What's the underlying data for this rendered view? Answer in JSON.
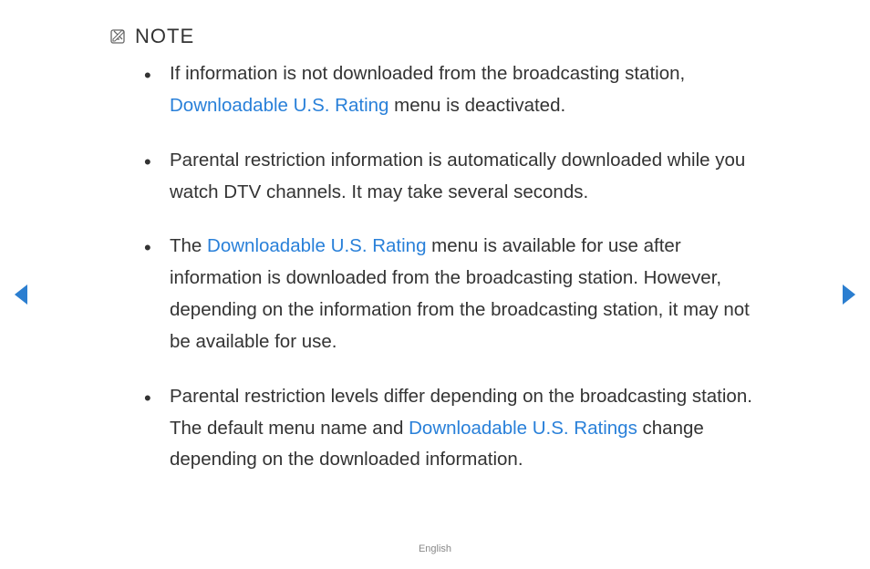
{
  "header": {
    "label": "NOTE"
  },
  "bullets": [
    {
      "pre": "If information is not downloaded from the broadcasting station, ",
      "link": "Downloadable U.S. Rating",
      "post": " menu is deactivated."
    },
    {
      "pre": "Parental restriction information is automatically downloaded while you watch DTV channels. It may take several seconds.",
      "link": "",
      "post": ""
    },
    {
      "pre": "The ",
      "link": "Downloadable U.S. Rating",
      "post": " menu is available for use after information is downloaded from the broadcasting station. However, depending on the information from the broadcasting station, it may not be available for use."
    },
    {
      "pre": "Parental restriction levels differ depending on the broadcasting station. The default menu name and ",
      "link": "Downloadable U.S. Ratings",
      "post": " change depending on the downloaded information."
    }
  ],
  "footer": {
    "language": "English"
  },
  "colors": {
    "link": "#2980d9",
    "arrow": "#2b7ed0"
  }
}
